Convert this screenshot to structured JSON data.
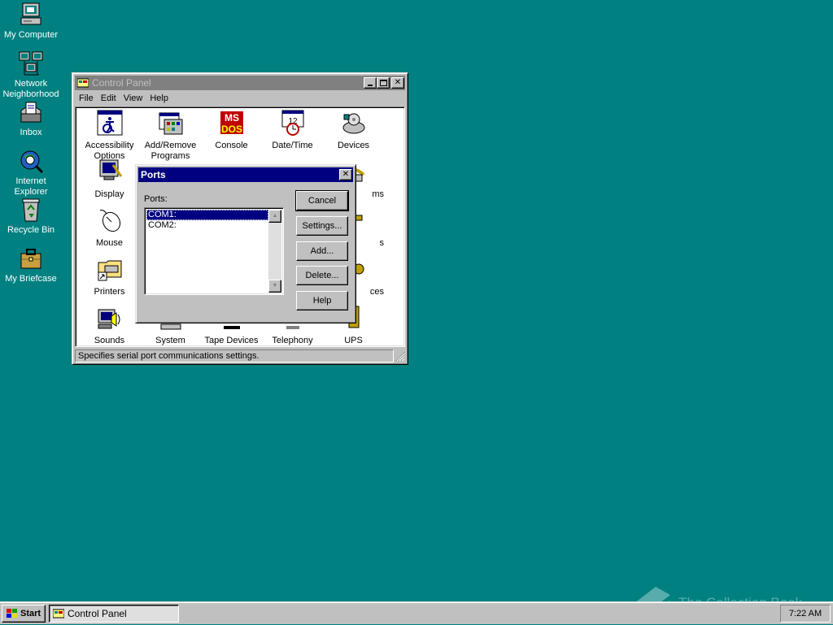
{
  "desktop": {
    "background": "#008080",
    "icons": [
      {
        "label": "My Computer",
        "icon": "computer-icon"
      },
      {
        "label": "Network Neighborhood",
        "icon": "network-icon"
      },
      {
        "label": "Inbox",
        "icon": "inbox-icon"
      },
      {
        "label": "Internet Explorer",
        "icon": "internet-explorer-icon"
      },
      {
        "label": "Recycle Bin",
        "icon": "recycle-bin-icon"
      },
      {
        "label": "My Briefcase",
        "icon": "briefcase-icon"
      }
    ]
  },
  "control_panel": {
    "title": "Control Panel",
    "menu": [
      "File",
      "Edit",
      "View",
      "Help"
    ],
    "items": [
      {
        "label": "Accessibility Options",
        "icon": "accessibility-icon"
      },
      {
        "label": "Add/Remove Programs",
        "icon": "add-remove-programs-icon"
      },
      {
        "label": "Console",
        "icon": "console-icon"
      },
      {
        "label": "Date/Time",
        "icon": "date-time-icon"
      },
      {
        "label": "Devices",
        "icon": "devices-icon"
      },
      {
        "label": "Display",
        "icon": "display-icon"
      },
      {
        "label": "ms",
        "icon": "modems-icon"
      },
      {
        "label": "Mouse",
        "icon": "mouse-icon"
      },
      {
        "label": "s",
        "icon": "ports-icon"
      },
      {
        "label": "Printers",
        "icon": "printers-icon"
      },
      {
        "label": "ces",
        "icon": "services-icon"
      },
      {
        "label": "Sounds",
        "icon": "sounds-icon"
      },
      {
        "label": "System",
        "icon": "system-icon"
      },
      {
        "label": "Tape Devices",
        "icon": "tape-devices-icon"
      },
      {
        "label": "Telephony",
        "icon": "telephony-icon"
      },
      {
        "label": "UPS",
        "icon": "ups-icon"
      }
    ],
    "status": "Specifies serial port communications settings."
  },
  "ports_dialog": {
    "title": "Ports",
    "list_label": "Ports:",
    "ports": [
      "COM1:",
      "COM2:"
    ],
    "selected": "COM1:",
    "buttons": {
      "cancel": "Cancel",
      "settings": "Settings...",
      "add": "Add...",
      "delete": "Delete...",
      "help": "Help"
    }
  },
  "taskbar": {
    "start_label": "Start",
    "tasks": [
      {
        "label": "Control Panel",
        "icon": "control-panel-icon"
      }
    ],
    "clock": "7:22 AM"
  },
  "watermark": "The Collection Book",
  "colors": {
    "desktop": "#008080",
    "active_title": "#000080",
    "inactive_title": "#808080",
    "face": "#c0c0c0"
  }
}
